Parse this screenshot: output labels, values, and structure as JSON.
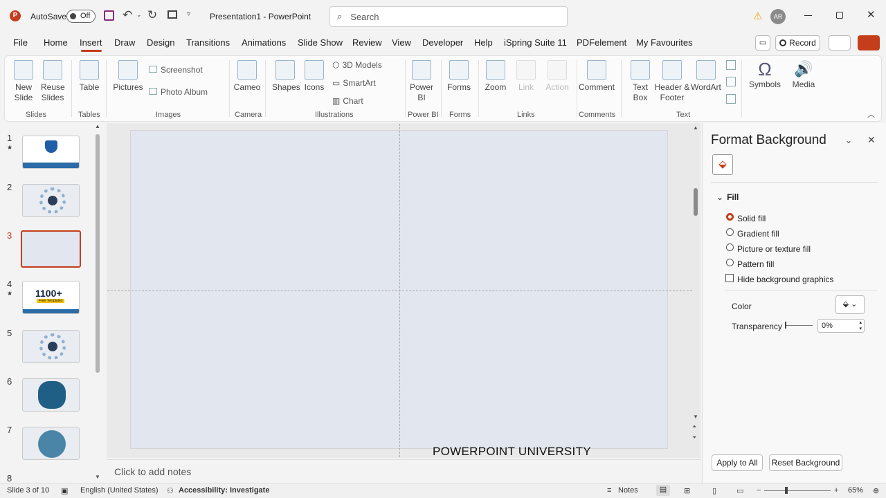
{
  "titlebar": {
    "autosave_label": "AutoSave",
    "autosave_state": "Off",
    "doc_title": "Presentation1 - PowerPoint",
    "search_placeholder": "Search",
    "avatar_initials": "AR",
    "colors": {
      "app_icon": "#c43e1c",
      "warning": "#e6a700"
    }
  },
  "tabs": [
    "File",
    "Home",
    "Insert",
    "Draw",
    "Design",
    "Transitions",
    "Animations",
    "Slide Show",
    "Review",
    "View",
    "Developer",
    "Help",
    "iSpring Suite 11",
    "PDFelement",
    "My Favourites"
  ],
  "record_label": "Record",
  "ribbon": {
    "slides": {
      "new_slide": "New Slide",
      "reuse_slides": "Reuse Slides",
      "group": "Slides"
    },
    "tables": {
      "table": "Table",
      "group": "Tables"
    },
    "images": {
      "pictures": "Pictures",
      "screenshot": "Screenshot",
      "photo_album": "Photo Album",
      "group": "Images"
    },
    "camera": {
      "cameo": "Cameo",
      "group": "Camera"
    },
    "illustrations": {
      "shapes": "Shapes",
      "icons": "Icons",
      "models3d": "3D Models",
      "smartart": "SmartArt",
      "chart": "Chart",
      "group": "Illustrations"
    },
    "powerbi": {
      "power_bi": "Power BI",
      "group": "Power BI"
    },
    "forms": {
      "forms": "Forms",
      "group": "Forms"
    },
    "links": {
      "zoom": "Zoom",
      "link": "Link",
      "action": "Action",
      "group": "Links"
    },
    "comments": {
      "comment": "Comment",
      "group": "Comments"
    },
    "text": {
      "text_box": "Text Box",
      "header_footer": "Header & Footer",
      "wordart": "WordArt",
      "group": "Text"
    },
    "symbols": {
      "symbols": "Symbols"
    },
    "media": {
      "media": "Media"
    }
  },
  "thumbnails": [
    {
      "num": "1",
      "star": "★"
    },
    {
      "num": "2",
      "star": ""
    },
    {
      "num": "3",
      "star": ""
    },
    {
      "num": "4",
      "star": "★",
      "text": "1100+",
      "subtext": "Free Templates"
    },
    {
      "num": "5",
      "star": ""
    },
    {
      "num": "6",
      "star": ""
    },
    {
      "num": "7",
      "star": ""
    },
    {
      "num": "8",
      "star": ""
    }
  ],
  "slide": {
    "watermark": "POWERPOINT UNIVERSITY",
    "notes_placeholder": "Click to add notes"
  },
  "pane": {
    "title": "Format Background",
    "section": "Fill",
    "options": [
      "Solid fill",
      "Gradient fill",
      "Picture or texture fill",
      "Pattern fill"
    ],
    "selected_option": "Solid fill",
    "hide_bg": "Hide background graphics",
    "color_label": "Color",
    "transparency_label": "Transparency",
    "transparency_value": "0%",
    "apply_all": "Apply to All",
    "reset": "Reset Background"
  },
  "status": {
    "slide_info": "Slide 3 of 10",
    "language": "English (United States)",
    "accessibility": "Accessibility: Investigate",
    "notes": "Notes",
    "zoom": "65%"
  }
}
